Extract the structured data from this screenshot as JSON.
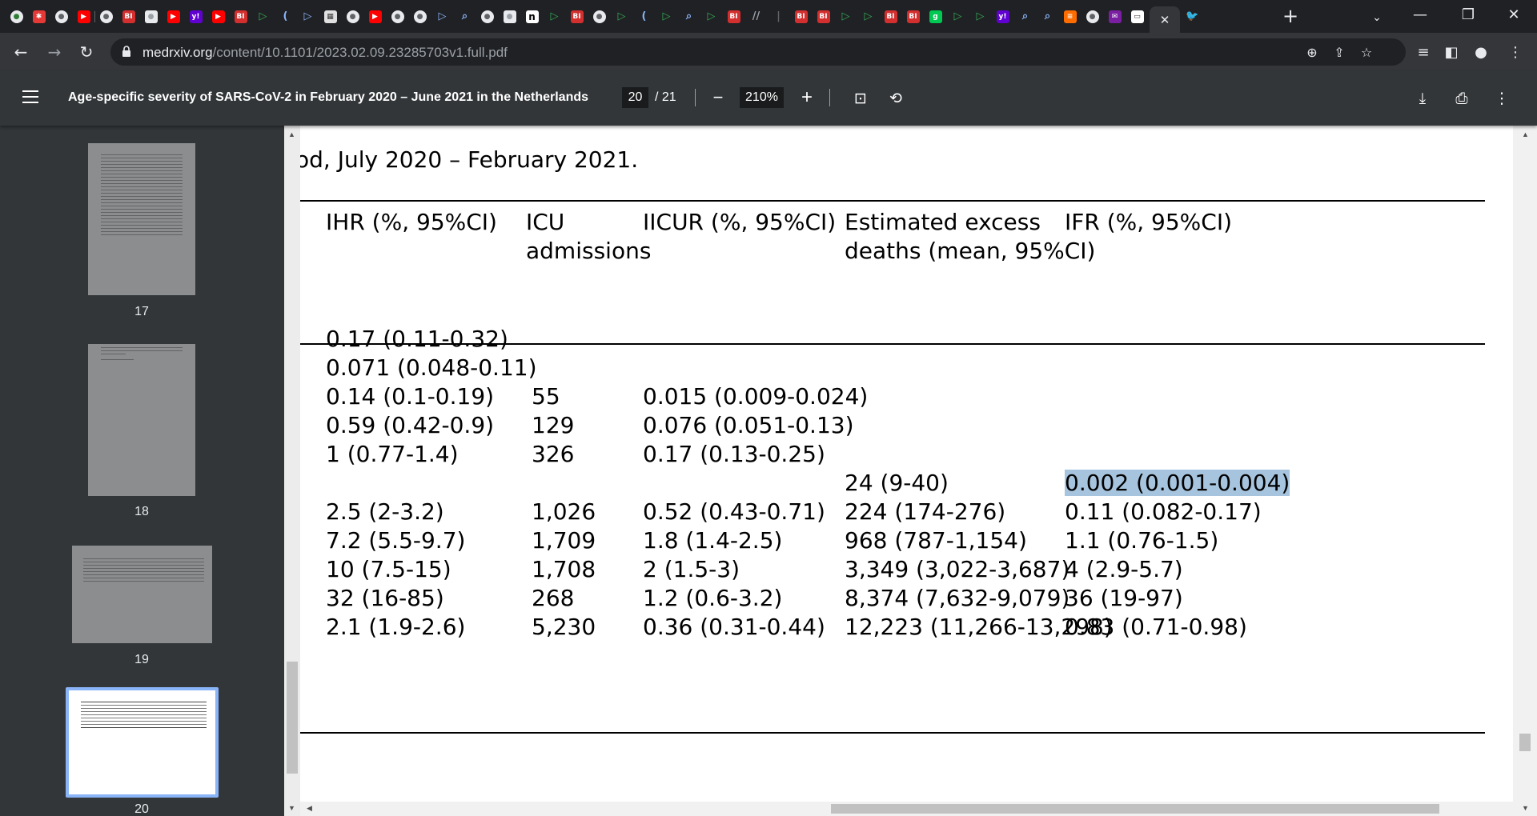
{
  "browser": {
    "tabs": [
      {
        "icon": "globe-icon",
        "color": "#2e7d32",
        "glyph": "●"
      },
      {
        "icon": "pinwheel-icon",
        "color": "#e53935",
        "glyph": "✱"
      },
      {
        "icon": "globe-icon",
        "color": "#5f6368",
        "glyph": "●"
      },
      {
        "icon": "youtube-icon",
        "color": "#ff0000",
        "glyph": "▶"
      },
      {
        "icon": "globe-icon",
        "color": "#5f6368",
        "glyph": "●"
      },
      {
        "icon": "bi-icon",
        "color": "#d32f2f",
        "glyph": "BI"
      },
      {
        "icon": "leaf-icon",
        "color": "#9aa0a6",
        "glyph": "●"
      },
      {
        "icon": "youtube-icon",
        "color": "#ff0000",
        "glyph": "▶"
      },
      {
        "icon": "yahoo-icon",
        "color": "#6001d2",
        "glyph": "y!"
      },
      {
        "icon": "youtube-icon",
        "color": "#ff0000",
        "glyph": "▶"
      },
      {
        "icon": "bi-icon",
        "color": "#d32f2f",
        "glyph": "BI"
      },
      {
        "icon": "play-icon",
        "color": "#34a853",
        "glyph": "▷"
      },
      {
        "icon": "arc-icon",
        "color": "#8ab4f8",
        "glyph": "("
      },
      {
        "icon": "arrow-icon",
        "color": "#8ab4f8",
        "glyph": "▷"
      },
      {
        "icon": "grid-icon",
        "color": "#e0e0e0",
        "glyph": "▦"
      },
      {
        "icon": "globe-icon",
        "color": "#5f6368",
        "glyph": "●"
      },
      {
        "icon": "youtube-icon",
        "color": "#ff0000",
        "glyph": "▶"
      },
      {
        "icon": "globe-icon",
        "color": "#5f6368",
        "glyph": "●"
      },
      {
        "icon": "globe-icon",
        "color": "#5f6368",
        "glyph": "●"
      },
      {
        "icon": "arrow-icon",
        "color": "#8ab4f8",
        "glyph": "▷"
      },
      {
        "icon": "search-icon",
        "color": "#8ab4f8",
        "glyph": "⌕"
      },
      {
        "icon": "globe-icon",
        "color": "#5f6368",
        "glyph": "●"
      },
      {
        "icon": "leaf-icon",
        "color": "#9aa0a6",
        "glyph": "●"
      },
      {
        "icon": "n-icon",
        "color": "#000000",
        "glyph": "n"
      },
      {
        "icon": "play-icon",
        "color": "#34a853",
        "glyph": "▷"
      },
      {
        "icon": "bi-icon",
        "color": "#d32f2f",
        "glyph": "BI"
      },
      {
        "icon": "globe-icon",
        "color": "#5f6368",
        "glyph": "●"
      },
      {
        "icon": "play-icon",
        "color": "#34a853",
        "glyph": "▷"
      },
      {
        "icon": "arc-icon",
        "color": "#8ab4f8",
        "glyph": "("
      },
      {
        "icon": "play-icon",
        "color": "#34a853",
        "glyph": "▷"
      },
      {
        "icon": "search-icon",
        "color": "#8ab4f8",
        "glyph": "⌕"
      },
      {
        "icon": "play-icon",
        "color": "#34a853",
        "glyph": "▷"
      },
      {
        "icon": "bi-icon",
        "color": "#d32f2f",
        "glyph": "BI"
      },
      {
        "icon": "slash-icon",
        "color": "#9aa0a6",
        "glyph": "//"
      },
      {
        "icon": "bar-icon",
        "color": "#5f6368",
        "glyph": "|"
      },
      {
        "icon": "bi-icon",
        "color": "#d32f2f",
        "glyph": "BI"
      },
      {
        "icon": "bi-icon",
        "color": "#d32f2f",
        "glyph": "BI"
      },
      {
        "icon": "play-icon",
        "color": "#34a853",
        "glyph": "▷"
      },
      {
        "icon": "play-icon",
        "color": "#34a853",
        "glyph": "▷"
      },
      {
        "icon": "bi-icon",
        "color": "#d32f2f",
        "glyph": "BI"
      },
      {
        "icon": "bi-icon",
        "color": "#d32f2f",
        "glyph": "BI"
      },
      {
        "icon": "g-icon",
        "color": "#00c853",
        "glyph": "g"
      },
      {
        "icon": "play-icon",
        "color": "#34a853",
        "glyph": "▷"
      },
      {
        "icon": "play-icon",
        "color": "#34a853",
        "glyph": "▷"
      },
      {
        "icon": "yahoo-icon",
        "color": "#6001d2",
        "glyph": "y!"
      },
      {
        "icon": "search-icon",
        "color": "#8ab4f8",
        "glyph": "⌕"
      },
      {
        "icon": "search-icon",
        "color": "#8ab4f8",
        "glyph": "⌕"
      },
      {
        "icon": "bookmark-icon",
        "color": "#ff6d00",
        "glyph": "≡"
      },
      {
        "icon": "globe-icon",
        "color": "#5f6368",
        "glyph": "●"
      },
      {
        "icon": "mail-icon",
        "color": "#7b1fa2",
        "glyph": "✉"
      },
      {
        "icon": "page-icon",
        "color": "#ffffff",
        "glyph": "▭"
      }
    ],
    "active_tab_close": "✕",
    "after_tab": {
      "icon": "twitter-icon",
      "color": "#1d9bf0",
      "glyph": "🐦"
    },
    "new_tab": "+",
    "tab_search": "⌄",
    "window_controls": {
      "minimize": "—",
      "restore": "❐",
      "close": "✕"
    },
    "nav": {
      "back": "←",
      "forward": "→",
      "reload": "↻"
    },
    "url_host": "medrxiv.org",
    "url_path": "/content/10.1101/2023.02.09.23285703v1.full.pdf"
  },
  "pdf": {
    "title": "Age-specific severity of SARS-CoV-2 in February 2020 – June 2021 in the Netherlands",
    "page_current": "20",
    "page_total": "/ 21",
    "zoom": "210%",
    "thumbnails": [
      {
        "label": "17"
      },
      {
        "label": "18"
      },
      {
        "label": "19"
      },
      {
        "label": "20"
      }
    ]
  },
  "document": {
    "caption": "od, July 2020 – February 2021.",
    "headers": [
      {
        "line1": "IHR (%, 95%CI)",
        "line2": ""
      },
      {
        "line1": "ICU",
        "line2": "admissions"
      },
      {
        "line1": "IICUR (%, 95%CI)",
        "line2": ""
      },
      {
        "line1": "Estimated excess",
        "line2": "deaths (mean, 95%CI)"
      },
      {
        "line1": "IFR (%, 95%CI)",
        "line2": ""
      }
    ],
    "rows": [
      [
        "0.17 (0.11-0.32)",
        "",
        "",
        "",
        ""
      ],
      [
        "0.071 (0.048-0.11)",
        "",
        "",
        "",
        ""
      ],
      [
        "0.14 (0.1-0.19)",
        "55",
        "0.015 (0.009-0.024)",
        "",
        ""
      ],
      [
        "0.59 (0.42-0.9)",
        "129",
        "0.076 (0.051-0.13)",
        "",
        ""
      ],
      [
        "1 (0.77-1.4)",
        "326",
        "0.17 (0.13-0.25)",
        "",
        ""
      ],
      [
        "",
        "",
        "",
        "24 (9-40)",
        "0.002 (0.001-0.004)"
      ],
      [
        "2.5 (2-3.2)",
        "1,026",
        "0.52 (0.43-0.71)",
        "224 (174-276)",
        "0.11 (0.082-0.17)"
      ],
      [
        "7.2 (5.5-9.7)",
        "1,709",
        "1.8 (1.4-2.5)",
        "968 (787-1,154)",
        "1.1 (0.76-1.5)"
      ],
      [
        "10 (7.5-15)",
        "1,708",
        "2 (1.5-3)",
        "3,349 (3,022-3,687)",
        "4 (2.9-5.7)"
      ],
      [
        "32 (16-85)",
        "268",
        "1.2 (0.6-3.2)",
        "8,374 (7,632-9,079)",
        "36 (19-97)"
      ],
      [
        "2.1 (1.9-2.6)",
        "5,230",
        "0.36 (0.31-0.44)",
        "12,223 (11,266-13,298)",
        "0.83 (0.71-0.98)"
      ]
    ],
    "highlight_color": "#a7c4de"
  }
}
